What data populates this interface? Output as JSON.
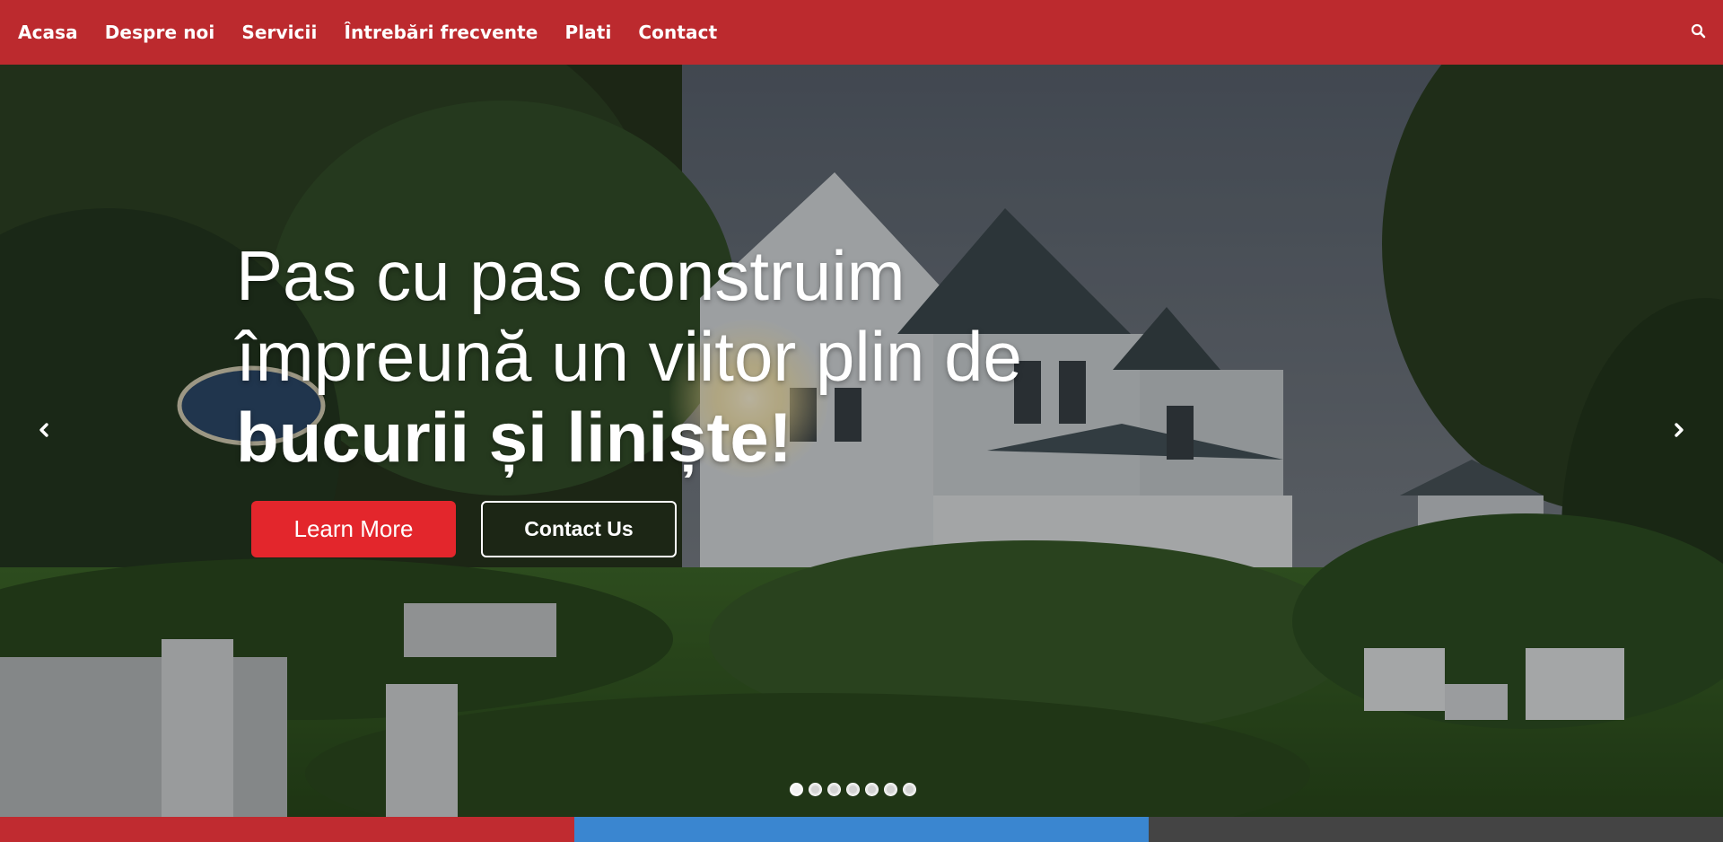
{
  "nav": {
    "items": [
      {
        "label": "Acasa"
      },
      {
        "label": "Despre noi"
      },
      {
        "label": "Servicii"
      },
      {
        "label": "Întrebări frecvente"
      },
      {
        "label": "Plati"
      },
      {
        "label": "Contact"
      }
    ],
    "search_icon": "search-icon",
    "background_color": "#bc2a2e"
  },
  "hero": {
    "title_line1": "Pas cu pas construim",
    "title_line2": "împreună un viitor plin de",
    "title_line3": "bucurii și liniște!",
    "primary_button": "Learn More",
    "secondary_button": "Contact Us",
    "primary_button_color": "#e3262c",
    "prev_icon": "chevron-left-icon",
    "next_icon": "chevron-right-icon",
    "slides_count": 7,
    "active_slide": 1
  },
  "bottom_strip": {
    "colors": [
      "#c02b30",
      "#3a86d0",
      "#444444"
    ]
  }
}
